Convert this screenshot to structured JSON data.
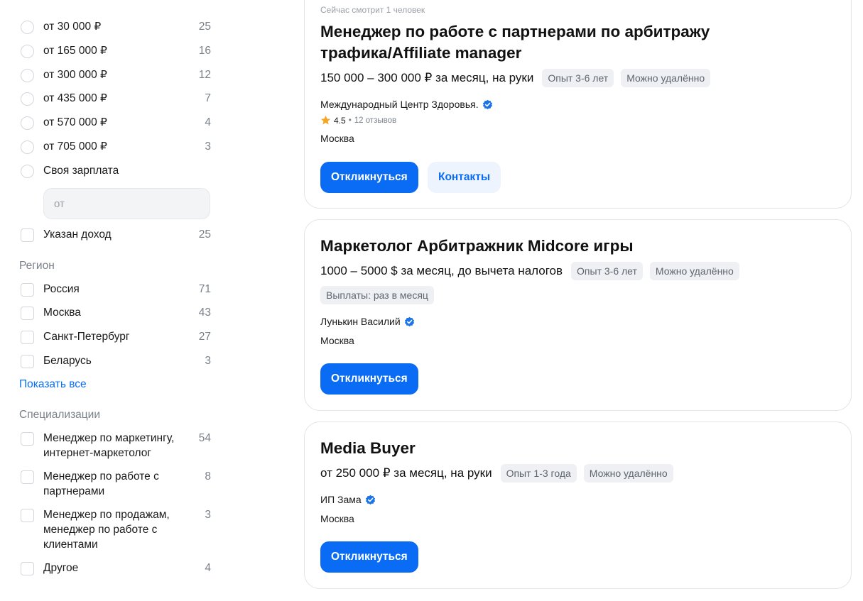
{
  "sidebar": {
    "salary_options": [
      {
        "label": "от 30 000 ₽",
        "count": "25"
      },
      {
        "label": "от 165 000 ₽",
        "count": "16"
      },
      {
        "label": "от 300 000 ₽",
        "count": "12"
      },
      {
        "label": "от 435 000 ₽",
        "count": "7"
      },
      {
        "label": "от 570 000 ₽",
        "count": "4"
      },
      {
        "label": "от 705 000 ₽",
        "count": "3"
      },
      {
        "label": "Своя зарплата",
        "count": ""
      }
    ],
    "salary_input_placeholder": "от",
    "income_specified": {
      "label": "Указан доход",
      "count": "25"
    },
    "region": {
      "title": "Регион",
      "items": [
        {
          "label": "Россия",
          "count": "71"
        },
        {
          "label": "Москва",
          "count": "43"
        },
        {
          "label": "Санкт-Петербург",
          "count": "27"
        },
        {
          "label": "Беларусь",
          "count": "3"
        }
      ],
      "show_all": "Показать все"
    },
    "specializations": {
      "title": "Специализации",
      "items": [
        {
          "label": "Менеджер по маркетингу, интернет-маркетолог",
          "count": "54"
        },
        {
          "label": "Менеджер по работе с партнерами",
          "count": "8"
        },
        {
          "label": "Менеджер по продажам, менеджер по работе с клиентами",
          "count": "3"
        },
        {
          "label": "Другое",
          "count": "4"
        }
      ]
    }
  },
  "vacancies": [
    {
      "viewing": "Сейчас смотрит 1 человек",
      "title": "Менеджер по работе с партнерами по арбитражу трафика/Affiliate manager",
      "compensation": "150 000 – 300 000 ₽ за месяц, на руки",
      "tags": [
        "Опыт 3-6 лет",
        "Можно удалённо"
      ],
      "employer": "Международный Центр Здоровья.",
      "rating": "4.5",
      "reviews": "12 отзывов",
      "city": "Москва",
      "apply_label": "Откликнуться",
      "contacts_label": "Контакты"
    },
    {
      "title": "Маркетолог Арбитражник Midcore игры",
      "compensation": "1000 – 5000 $ за месяц, до вычета налогов",
      "tags": [
        "Опыт 3-6 лет",
        "Можно удалённо",
        "Выплаты: раз в месяц"
      ],
      "employer": "Лунькин Василий",
      "city": "Москва",
      "apply_label": "Откликнуться"
    },
    {
      "title": "Media Buyer",
      "compensation": "от 250 000 ₽ за месяц, на руки",
      "tags": [
        "Опыт 1-3 года",
        "Можно удалённо"
      ],
      "employer": "ИП Зама",
      "city": "Москва",
      "apply_label": "Откликнуться"
    }
  ],
  "colors": {
    "accent": "#0a6cf5",
    "verified": "#1a73e8",
    "star": "#f5a623"
  }
}
